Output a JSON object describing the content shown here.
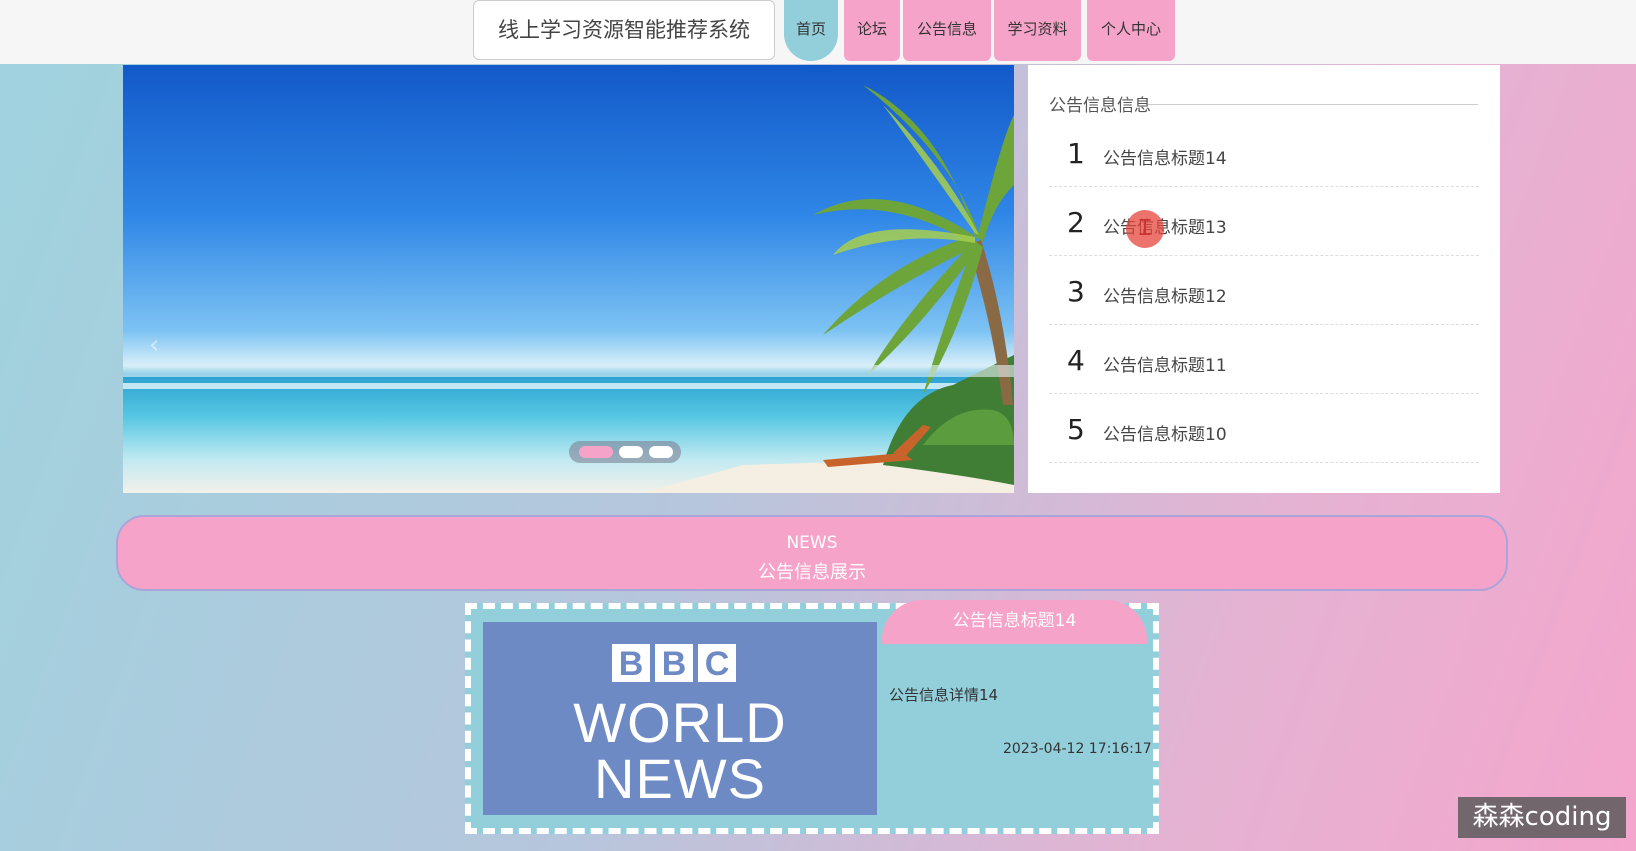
{
  "header": {
    "site_title": "线上学习资源智能推荐系统",
    "nav": [
      {
        "label": "首页",
        "active": true
      },
      {
        "label": "论坛"
      },
      {
        "label": "公告信息"
      },
      {
        "label": "学习资料"
      },
      {
        "label": "个人中心"
      }
    ]
  },
  "slider": {
    "prev_icon": "‹",
    "slide_count": 3,
    "active_index": 0
  },
  "notice_panel": {
    "heading": "公告信息信息",
    "items": [
      {
        "num": "1",
        "title": "公告信息标题14"
      },
      {
        "num": "2",
        "title": "公告信息标题13"
      },
      {
        "num": "3",
        "title": "公告信息标题12"
      },
      {
        "num": "4",
        "title": "公告信息标题11"
      },
      {
        "num": "5",
        "title": "公告信息标题10"
      }
    ]
  },
  "news_section": {
    "label_en": "NEWS",
    "label_cn": "公告信息展示"
  },
  "news_card": {
    "logo_letters": [
      "B",
      "B",
      "C"
    ],
    "logo_line1": "WORLD",
    "logo_line2": "NEWS",
    "title": "公告信息标题14",
    "detail": "公告信息详情14",
    "time": "2023-04-12 17:16:17"
  },
  "watermark": "森森coding",
  "colors": {
    "pink": "#f6a3c9",
    "teal": "#92cfdb",
    "bbc_blue": "#6d8ac5"
  }
}
